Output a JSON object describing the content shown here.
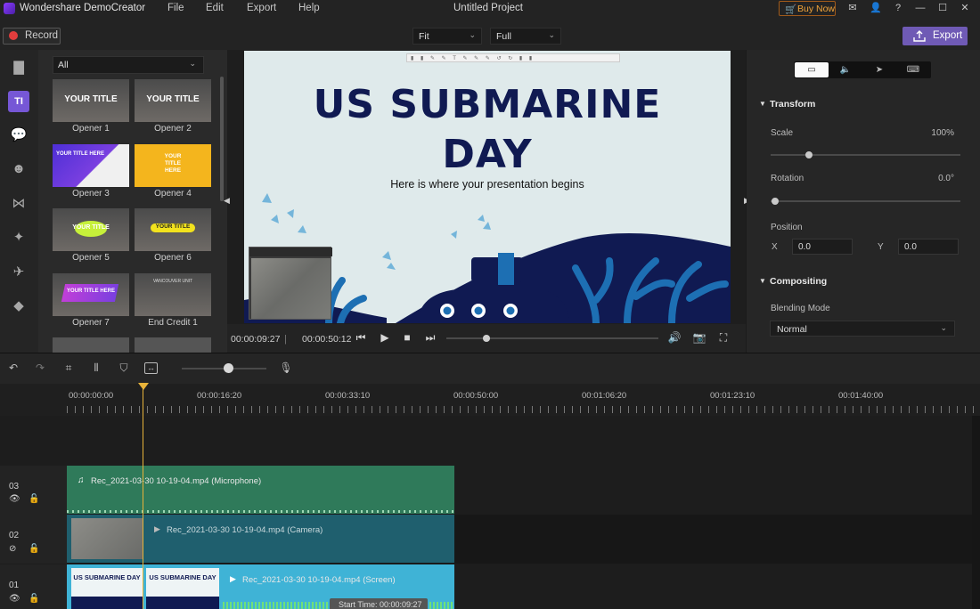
{
  "titlebar": {
    "app_title": "Wondershare DemoCreator",
    "menu": [
      "File",
      "Edit",
      "Export",
      "Help"
    ],
    "project": "Untitled Project",
    "buy_now": "Buy Now"
  },
  "toolbar": {
    "record_label": "Record",
    "fit_value": "Fit",
    "full_value": "Full",
    "export_label": "Export"
  },
  "library": {
    "filter_value": "All",
    "items": [
      {
        "label": "Opener 1",
        "thumb_text": "YOUR TITLE"
      },
      {
        "label": "Opener 2",
        "thumb_text": "YOUR TITLE"
      },
      {
        "label": "Opener 3",
        "thumb_text": "YOUR TITLE HERE"
      },
      {
        "label": "Opener 4",
        "thumb_text": "YOUR TITLE HERE"
      },
      {
        "label": "Opener 5",
        "thumb_text": "YOUR TITLE"
      },
      {
        "label": "Opener 6",
        "thumb_text": "YOUR TITLE"
      },
      {
        "label": "Opener 7",
        "thumb_text": "YOUR TITLE HERE"
      },
      {
        "label": "End Credit 1",
        "thumb_text": "VANCOUVER UNIT"
      }
    ]
  },
  "preview": {
    "slide_title_line1": "US SUBMARINE",
    "slide_title_line2": "DAY",
    "slide_subtitle": "Here is where your presentation begins",
    "current_time": "00:00:09:27",
    "total_time": "00:00:50:12",
    "playback_progress": 0.19
  },
  "properties": {
    "transform_label": "Transform",
    "scale_label": "Scale",
    "scale_value": "100%",
    "scale_level": 0.2,
    "rotation_label": "Rotation",
    "rotation_value": "0.0°",
    "rotation_level": 0.0,
    "position_label": "Position",
    "x_label": "X",
    "x_value": "0.0",
    "y_label": "Y",
    "y_value": "0.0",
    "compositing_label": "Compositing",
    "blending_label": "Blending Mode",
    "blending_value": "Normal"
  },
  "timeline": {
    "zoom_level": 0.55,
    "ruler_labels": [
      "00:00:00:00",
      "00:00:16:20",
      "00:00:33:10",
      "00:00:50:00",
      "00:01:06:20",
      "00:01:23:10",
      "00:01:40:00"
    ],
    "tracks": [
      {
        "num": "03",
        "clip": "Rec_2021-03-30 10-19-04.mp4 (Microphone)"
      },
      {
        "num": "02",
        "clip": "Rec_2021-03-30 10-19-04.mp4 (Camera)"
      },
      {
        "num": "01",
        "clip": "Rec_2021-03-30 10-19-04.mp4 (Screen)"
      }
    ],
    "screen_thumb_text": "US SUBMARINE DAY",
    "tooltip": "Start Time: 00:00:09:27"
  },
  "colors": {
    "accent": "#7657d6",
    "export": "#6f5ab5",
    "audio_clip": "#2f7a5a",
    "camera_clip": "#1f5f6e",
    "screen_clip": "#3fb3d6",
    "playhead": "#e8b33a",
    "slide_navy": "#101a52",
    "slide_blue": "#1d6fb3"
  }
}
